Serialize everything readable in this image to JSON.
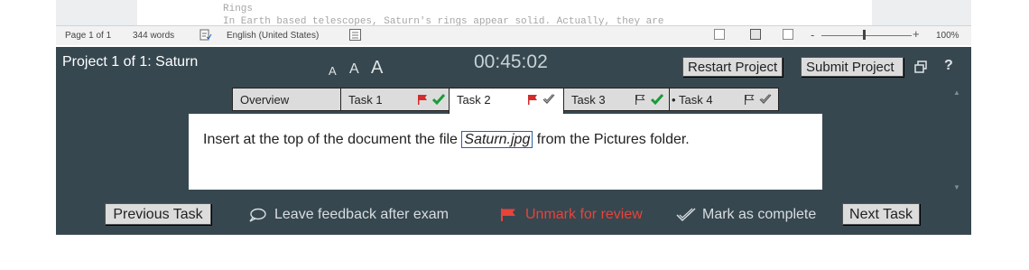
{
  "document": {
    "line1": "Rings",
    "line2": "In Earth based telescopes, Saturn's rings appear solid. Actually, they are"
  },
  "statusbar": {
    "page": "Page 1 of 1",
    "words": "344 words",
    "language": "English (United States)",
    "zoom": "100%",
    "zoom_minus": "-",
    "zoom_plus": "+"
  },
  "header": {
    "project": "Project 1 of 1: Saturn",
    "font_small": "A",
    "font_medium": "A",
    "font_large": "A",
    "timer": "00:45:02",
    "restart_label": "Restart Project",
    "submit_label": "Submit Project",
    "help": "?"
  },
  "tabs": [
    {
      "label": "Overview",
      "flag": "none",
      "check": "none"
    },
    {
      "label": "Task 1",
      "flag": "red",
      "check": "filled"
    },
    {
      "label": "Task 2",
      "flag": "red",
      "check": "outline",
      "active": true
    },
    {
      "label": "Task 3",
      "flag": "outline",
      "check": "filled"
    },
    {
      "label": "Task 4",
      "flag": "outline",
      "check": "outline",
      "bullet": "•"
    }
  ],
  "task": {
    "before": "Insert at the top of the document the file ",
    "filename": "Saturn.jpg",
    "after": " from the Pictures folder."
  },
  "footer": {
    "prev_label": "Previous Task",
    "feedback_label": "Leave feedback after exam",
    "unmark_label": "Unmark for review",
    "complete_label": "Mark as complete",
    "next_label": "Next Task"
  },
  "colors": {
    "panel": "#36474f",
    "flag_red": "#d42b2b",
    "check_green": "#1a9a3a",
    "unmark_text": "#e8433b"
  }
}
